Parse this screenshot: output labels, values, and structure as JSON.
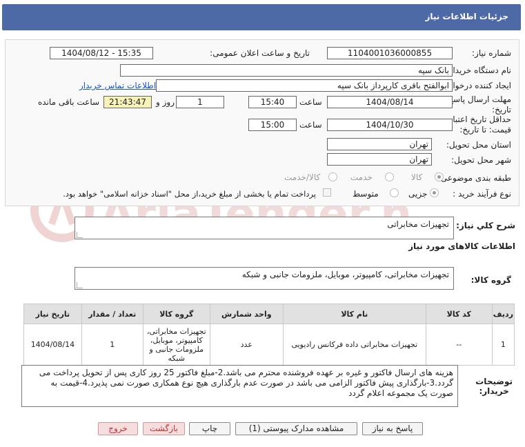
{
  "page": {
    "title": "جزئیات اطلاعات نیاز"
  },
  "fields": {
    "need_number_label": "شماره نیاز:",
    "need_number": "1104001036000855",
    "announce_label": "تاریخ و ساعت اعلان عمومی:",
    "announce_value": "1404/08/12 - 15:35",
    "buyer_org_label": "نام دستگاه خریدار:",
    "buyer_org": "بانک سپه",
    "creator_label": "ایجاد کننده درخواست:",
    "creator": "ابوالفتح باقری کارپرداز بانک سپه",
    "contact_link": "اطلاعات تماس خریدار",
    "deadline_label": "مهلت ارسال پاسخ: تا تاریخ:",
    "deadline_date": "1404/08/14",
    "time_label": "ساعت",
    "deadline_time": "15:40",
    "days": "1",
    "days_label": "روز و",
    "remaining": "21:43:47",
    "remaining_label": "ساعت باقی مانده",
    "min_price_label": "حداقل تاریخ اعتبار قیمت: تا تاریخ:",
    "min_price_date": "1404/10/30",
    "min_price_time": "15:00",
    "province_label": "استان محل تحویل:",
    "province": "تهران",
    "city_label": "شهر محل تحویل:",
    "city": "تهران",
    "category_label": "طبقه بندی موضوعی:",
    "cat_goods": "کالا",
    "cat_service": "خدمت",
    "cat_both": "کالا/خدمت",
    "process_label": "نوع فرآیند خرید :",
    "proc_minor": "جزیی",
    "proc_medium": "متوسط",
    "payment_note": "پرداخت تمام یا بخشی از مبلغ خرید،از محل \"اسناد خزانه اسلامی\" خواهد بود."
  },
  "summary": {
    "label": "شرح کلي نياز:",
    "value": "تجهیزات مخابراتی",
    "goods_info_title": "اطلاعات کالاهای مورد نیاز",
    "group_label": "گروه کالا:",
    "group_value": "تجهیزات مخابراتی، کامپیوتر، موبایل، ملزومات جانبی و شبکه"
  },
  "table": {
    "headers": [
      "ردیف",
      "کد کالا",
      "نام کالا",
      "واحد شمارش",
      "گروه کالا",
      "تعداد / مقدار",
      "تاریخ نیاز"
    ],
    "rows": [
      {
        "row": "1",
        "code": "--",
        "name": "تجهیزات مخابراتی داده فرکانس رادیویی",
        "unit": "عدد",
        "group": "تجهیزات مخابراتی، کامپیوتر، موبایل، ملزومات جانبی و شبکه",
        "qty": "1",
        "date": "1404/08/14"
      }
    ]
  },
  "notes": {
    "label_line1": "توضیحات",
    "label_line2": "خریدار:",
    "text": "هزینه های ارسال فاکتور و غیره بر عهده فروشنده محترم می باشد.2-مبلغ فاکتور 25 روز کاری پس از تحویل پرداخت می گردد.3-بارگذاری پیش فاکتور الزامی می باشد در صورت عدم بارگذاری هیچ نوع همکاری صورت نمی پذیرد.4-قیمت به صورت یک مجموعه اعلام گردد"
  },
  "buttons": {
    "reply": "پاسخ به نیاز",
    "attachments": "مشاهده مدارک پیوستی (1)",
    "print": "چاپ",
    "back": "بازگشت",
    "exit": "خروج"
  },
  "colors": {
    "header": "#4e6aa6",
    "link": "#1a56c5",
    "remaining_bg": "#f6f2b8"
  }
}
